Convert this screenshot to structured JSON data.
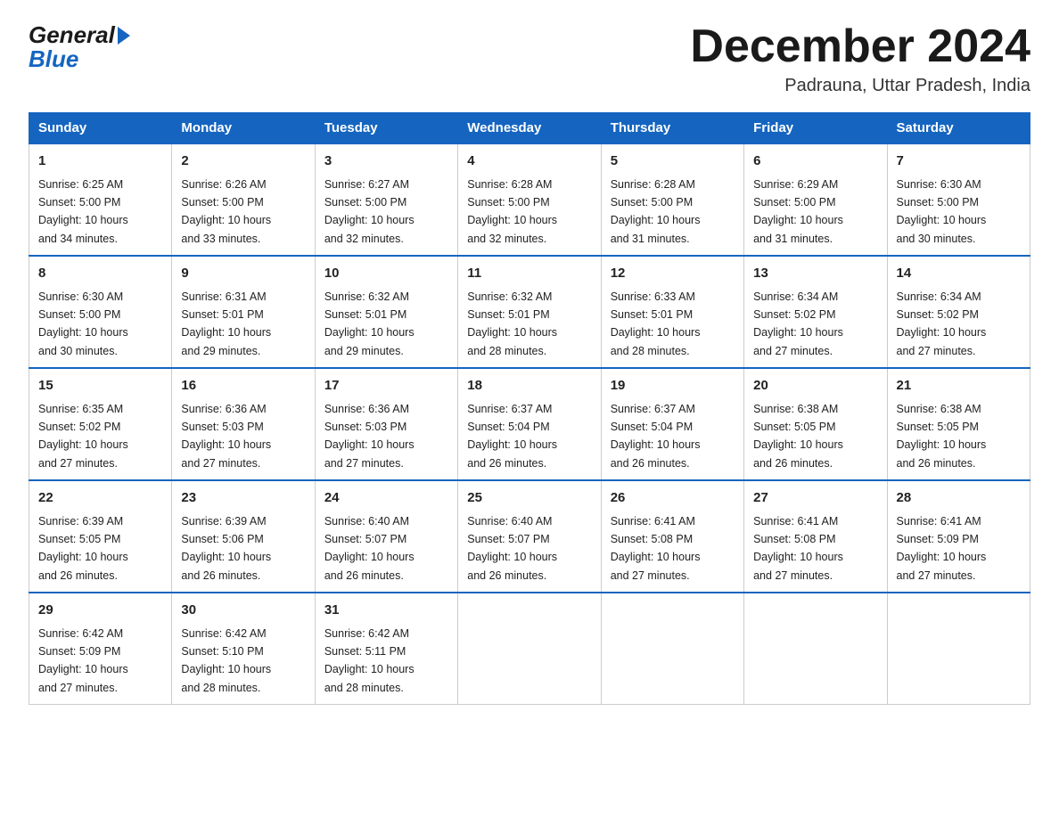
{
  "header": {
    "logo_line1": "General",
    "logo_arrow": "▶",
    "logo_line2": "Blue",
    "month_title": "December 2024",
    "location": "Padrauna, Uttar Pradesh, India"
  },
  "days_of_week": [
    "Sunday",
    "Monday",
    "Tuesday",
    "Wednesday",
    "Thursday",
    "Friday",
    "Saturday"
  ],
  "weeks": [
    [
      {
        "day": "1",
        "sunrise": "6:25 AM",
        "sunset": "5:00 PM",
        "daylight": "10 hours and 34 minutes."
      },
      {
        "day": "2",
        "sunrise": "6:26 AM",
        "sunset": "5:00 PM",
        "daylight": "10 hours and 33 minutes."
      },
      {
        "day": "3",
        "sunrise": "6:27 AM",
        "sunset": "5:00 PM",
        "daylight": "10 hours and 32 minutes."
      },
      {
        "day": "4",
        "sunrise": "6:28 AM",
        "sunset": "5:00 PM",
        "daylight": "10 hours and 32 minutes."
      },
      {
        "day": "5",
        "sunrise": "6:28 AM",
        "sunset": "5:00 PM",
        "daylight": "10 hours and 31 minutes."
      },
      {
        "day": "6",
        "sunrise": "6:29 AM",
        "sunset": "5:00 PM",
        "daylight": "10 hours and 31 minutes."
      },
      {
        "day": "7",
        "sunrise": "6:30 AM",
        "sunset": "5:00 PM",
        "daylight": "10 hours and 30 minutes."
      }
    ],
    [
      {
        "day": "8",
        "sunrise": "6:30 AM",
        "sunset": "5:00 PM",
        "daylight": "10 hours and 30 minutes."
      },
      {
        "day": "9",
        "sunrise": "6:31 AM",
        "sunset": "5:01 PM",
        "daylight": "10 hours and 29 minutes."
      },
      {
        "day": "10",
        "sunrise": "6:32 AM",
        "sunset": "5:01 PM",
        "daylight": "10 hours and 29 minutes."
      },
      {
        "day": "11",
        "sunrise": "6:32 AM",
        "sunset": "5:01 PM",
        "daylight": "10 hours and 28 minutes."
      },
      {
        "day": "12",
        "sunrise": "6:33 AM",
        "sunset": "5:01 PM",
        "daylight": "10 hours and 28 minutes."
      },
      {
        "day": "13",
        "sunrise": "6:34 AM",
        "sunset": "5:02 PM",
        "daylight": "10 hours and 27 minutes."
      },
      {
        "day": "14",
        "sunrise": "6:34 AM",
        "sunset": "5:02 PM",
        "daylight": "10 hours and 27 minutes."
      }
    ],
    [
      {
        "day": "15",
        "sunrise": "6:35 AM",
        "sunset": "5:02 PM",
        "daylight": "10 hours and 27 minutes."
      },
      {
        "day": "16",
        "sunrise": "6:36 AM",
        "sunset": "5:03 PM",
        "daylight": "10 hours and 27 minutes."
      },
      {
        "day": "17",
        "sunrise": "6:36 AM",
        "sunset": "5:03 PM",
        "daylight": "10 hours and 27 minutes."
      },
      {
        "day": "18",
        "sunrise": "6:37 AM",
        "sunset": "5:04 PM",
        "daylight": "10 hours and 26 minutes."
      },
      {
        "day": "19",
        "sunrise": "6:37 AM",
        "sunset": "5:04 PM",
        "daylight": "10 hours and 26 minutes."
      },
      {
        "day": "20",
        "sunrise": "6:38 AM",
        "sunset": "5:05 PM",
        "daylight": "10 hours and 26 minutes."
      },
      {
        "day": "21",
        "sunrise": "6:38 AM",
        "sunset": "5:05 PM",
        "daylight": "10 hours and 26 minutes."
      }
    ],
    [
      {
        "day": "22",
        "sunrise": "6:39 AM",
        "sunset": "5:05 PM",
        "daylight": "10 hours and 26 minutes."
      },
      {
        "day": "23",
        "sunrise": "6:39 AM",
        "sunset": "5:06 PM",
        "daylight": "10 hours and 26 minutes."
      },
      {
        "day": "24",
        "sunrise": "6:40 AM",
        "sunset": "5:07 PM",
        "daylight": "10 hours and 26 minutes."
      },
      {
        "day": "25",
        "sunrise": "6:40 AM",
        "sunset": "5:07 PM",
        "daylight": "10 hours and 26 minutes."
      },
      {
        "day": "26",
        "sunrise": "6:41 AM",
        "sunset": "5:08 PM",
        "daylight": "10 hours and 27 minutes."
      },
      {
        "day": "27",
        "sunrise": "6:41 AM",
        "sunset": "5:08 PM",
        "daylight": "10 hours and 27 minutes."
      },
      {
        "day": "28",
        "sunrise": "6:41 AM",
        "sunset": "5:09 PM",
        "daylight": "10 hours and 27 minutes."
      }
    ],
    [
      {
        "day": "29",
        "sunrise": "6:42 AM",
        "sunset": "5:09 PM",
        "daylight": "10 hours and 27 minutes."
      },
      {
        "day": "30",
        "sunrise": "6:42 AM",
        "sunset": "5:10 PM",
        "daylight": "10 hours and 28 minutes."
      },
      {
        "day": "31",
        "sunrise": "6:42 AM",
        "sunset": "5:11 PM",
        "daylight": "10 hours and 28 minutes."
      },
      null,
      null,
      null,
      null
    ]
  ],
  "labels": {
    "sunrise": "Sunrise:",
    "sunset": "Sunset:",
    "daylight": "Daylight:"
  }
}
